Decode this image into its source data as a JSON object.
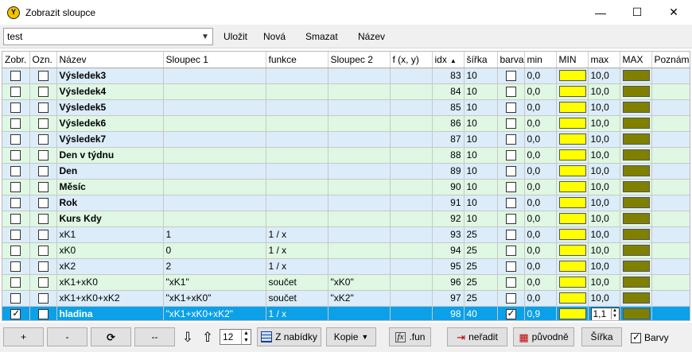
{
  "window": {
    "title": "Zobrazit sloupce",
    "minimize_glyph": "—",
    "maximize_glyph": "☐",
    "close_glyph": "✕",
    "app_icon_glyph": "Y"
  },
  "toolbar": {
    "combo_value": "test",
    "save_label": "Uložit",
    "new_label": "Nová",
    "delete_label": "Smazat",
    "name_label": "Název"
  },
  "grid": {
    "columns": [
      "Zobr.",
      "Ozn.",
      "Název",
      "Sloupec 1",
      "funkce",
      "Sloupec 2",
      "f (x, y)",
      "idx",
      "šířka",
      "barva",
      "min",
      "MIN",
      "max",
      "MAX",
      "Poznám"
    ],
    "sort_indicator": "▲",
    "rows": [
      {
        "zobr": false,
        "ozn": false,
        "nazev": "Výsledek3",
        "bold": true,
        "sloupec1": "",
        "funkce": "",
        "sloupec2": "",
        "fxy": "",
        "idx": "83",
        "sirka": "10",
        "barva": false,
        "min": "0,0",
        "max": "10,0",
        "selected": false
      },
      {
        "zobr": false,
        "ozn": false,
        "nazev": "Výsledek4",
        "bold": true,
        "sloupec1": "",
        "funkce": "",
        "sloupec2": "",
        "fxy": "",
        "idx": "84",
        "sirka": "10",
        "barva": false,
        "min": "0,0",
        "max": "10,0",
        "selected": false
      },
      {
        "zobr": false,
        "ozn": false,
        "nazev": "Výsledek5",
        "bold": true,
        "sloupec1": "",
        "funkce": "",
        "sloupec2": "",
        "fxy": "",
        "idx": "85",
        "sirka": "10",
        "barva": false,
        "min": "0,0",
        "max": "10,0",
        "selected": false
      },
      {
        "zobr": false,
        "ozn": false,
        "nazev": "Výsledek6",
        "bold": true,
        "sloupec1": "",
        "funkce": "",
        "sloupec2": "",
        "fxy": "",
        "idx": "86",
        "sirka": "10",
        "barva": false,
        "min": "0,0",
        "max": "10,0",
        "selected": false
      },
      {
        "zobr": false,
        "ozn": false,
        "nazev": "Výsledek7",
        "bold": true,
        "sloupec1": "",
        "funkce": "",
        "sloupec2": "",
        "fxy": "",
        "idx": "87",
        "sirka": "10",
        "barva": false,
        "min": "0,0",
        "max": "10,0",
        "selected": false
      },
      {
        "zobr": false,
        "ozn": false,
        "nazev": "Den v týdnu",
        "bold": true,
        "sloupec1": "",
        "funkce": "",
        "sloupec2": "",
        "fxy": "",
        "idx": "88",
        "sirka": "10",
        "barva": false,
        "min": "0,0",
        "max": "10,0",
        "selected": false
      },
      {
        "zobr": false,
        "ozn": false,
        "nazev": "Den",
        "bold": true,
        "sloupec1": "",
        "funkce": "",
        "sloupec2": "",
        "fxy": "",
        "idx": "89",
        "sirka": "10",
        "barva": false,
        "min": "0,0",
        "max": "10,0",
        "selected": false
      },
      {
        "zobr": false,
        "ozn": false,
        "nazev": "Měsíc",
        "bold": true,
        "sloupec1": "",
        "funkce": "",
        "sloupec2": "",
        "fxy": "",
        "idx": "90",
        "sirka": "10",
        "barva": false,
        "min": "0,0",
        "max": "10,0",
        "selected": false
      },
      {
        "zobr": false,
        "ozn": false,
        "nazev": "Rok",
        "bold": true,
        "sloupec1": "",
        "funkce": "",
        "sloupec2": "",
        "fxy": "",
        "idx": "91",
        "sirka": "10",
        "barva": false,
        "min": "0,0",
        "max": "10,0",
        "selected": false
      },
      {
        "zobr": false,
        "ozn": false,
        "nazev": "Kurs Kdy",
        "bold": true,
        "sloupec1": "",
        "funkce": "",
        "sloupec2": "",
        "fxy": "",
        "idx": "92",
        "sirka": "10",
        "barva": false,
        "min": "0,0",
        "max": "10,0",
        "selected": false
      },
      {
        "zobr": false,
        "ozn": false,
        "nazev": "xK1",
        "bold": false,
        "sloupec1": "1",
        "funkce": "1 / x",
        "sloupec2": "",
        "fxy": "",
        "idx": "93",
        "sirka": "25",
        "barva": false,
        "min": "0,0",
        "max": "10,0",
        "selected": false
      },
      {
        "zobr": false,
        "ozn": false,
        "nazev": "xK0",
        "bold": false,
        "sloupec1": "0",
        "funkce": "1 / x",
        "sloupec2": "",
        "fxy": "",
        "idx": "94",
        "sirka": "25",
        "barva": false,
        "min": "0,0",
        "max": "10,0",
        "selected": false
      },
      {
        "zobr": false,
        "ozn": false,
        "nazev": "xK2",
        "bold": false,
        "sloupec1": "2",
        "funkce": "1 / x",
        "sloupec2": "",
        "fxy": "",
        "idx": "95",
        "sirka": "25",
        "barva": false,
        "min": "0,0",
        "max": "10,0",
        "selected": false
      },
      {
        "zobr": false,
        "ozn": false,
        "nazev": "xK1+xK0",
        "bold": false,
        "sloupec1": "\"xK1\"",
        "funkce": "součet",
        "sloupec2": "\"xK0\"",
        "fxy": "",
        "idx": "96",
        "sirka": "25",
        "barva": false,
        "min": "0,0",
        "max": "10,0",
        "selected": false
      },
      {
        "zobr": false,
        "ozn": false,
        "nazev": "xK1+xK0+xK2",
        "bold": false,
        "sloupec1": "\"xK1+xK0\"",
        "funkce": "součet",
        "sloupec2": "\"xK2\"",
        "fxy": "",
        "idx": "97",
        "sirka": "25",
        "barva": false,
        "min": "0,0",
        "max": "10,0",
        "selected": false
      },
      {
        "zobr": true,
        "ozn": false,
        "nazev": "hladina",
        "bold": true,
        "sloupec1": "\"xK1+xK0+xK2\"",
        "funkce": "1 / x",
        "sloupec2": "",
        "fxy": "",
        "idx": "98",
        "sirka": "40",
        "barva": true,
        "min": "0,9",
        "max": "1,1",
        "selected": true
      }
    ],
    "min_color": "#ffff00",
    "max_color": "#808000"
  },
  "bottombar": {
    "add_label": "+",
    "remove_label": "-",
    "refresh_glyph": "⟳",
    "dash_label": "--",
    "down_glyph": "⇩",
    "up_glyph": "⇧",
    "spin_value": "12",
    "from_menu_label": "Z nabídky",
    "copy_label": "Kopie",
    "fun_label": ".fun",
    "fx_glyph": "fx",
    "unsort_label": "neřadit",
    "original_label": "původně",
    "width_label": "Šířka",
    "colors_label": "Barvy",
    "colors_checked": true
  },
  "colors": {
    "selection": "#0ba0e8",
    "row_odd": "#dcecf8",
    "row_even": "#dff7e3"
  }
}
